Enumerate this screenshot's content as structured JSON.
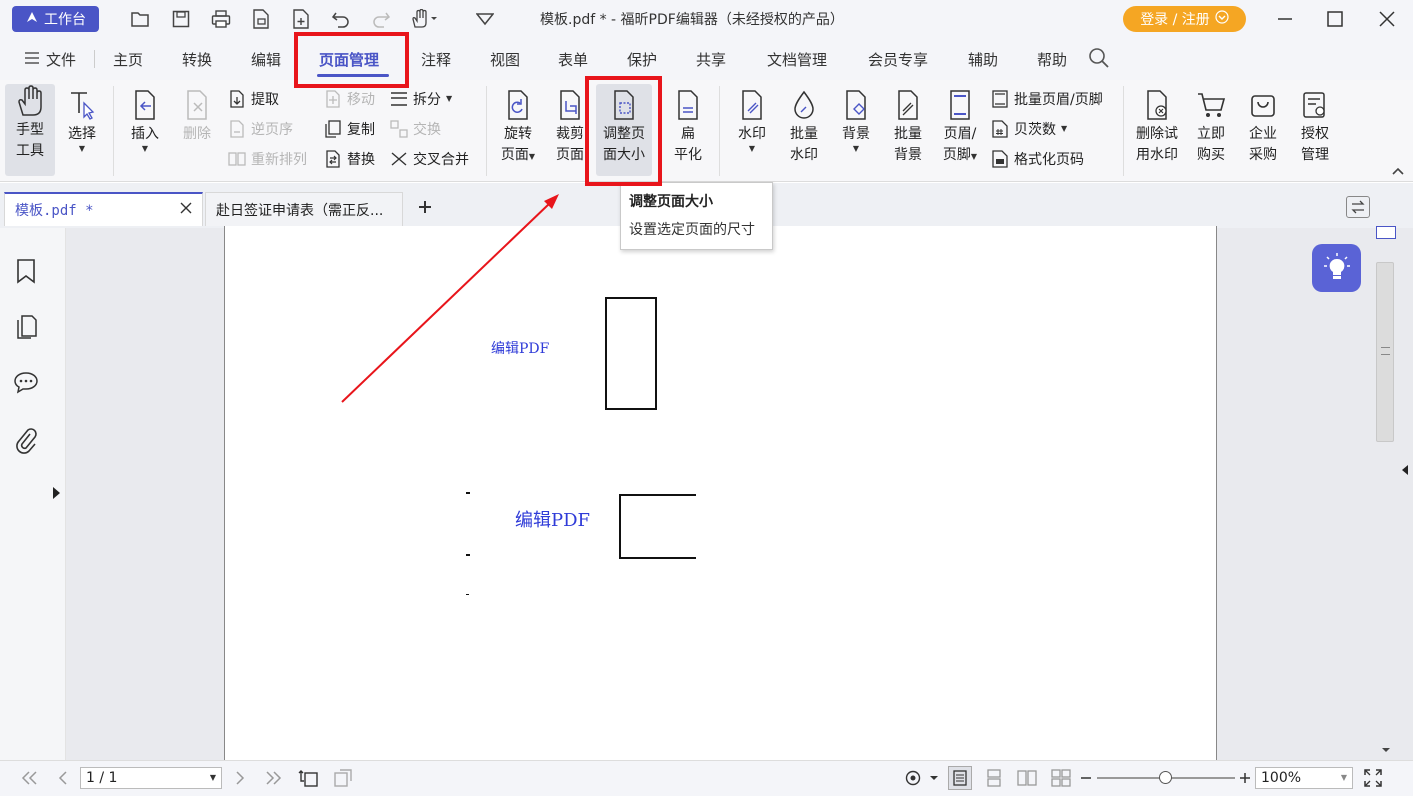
{
  "titlebar": {
    "workspace": "工作台",
    "title": "模板.pdf * - 福昕PDF编辑器（未经授权的产品）",
    "login": "登录 / 注册"
  },
  "menu": [
    "文件",
    "主页",
    "转换",
    "编辑",
    "页面管理",
    "注释",
    "视图",
    "表单",
    "保护",
    "共享",
    "文档管理",
    "会员专享",
    "辅助",
    "帮助"
  ],
  "menu_active": "页面管理",
  "ribbon": {
    "hand": [
      "手型",
      "工具"
    ],
    "select": "选择",
    "insert": "插入",
    "delete": "删除",
    "extract": "提取",
    "reverse": "逆页序",
    "reorder": "重新排列",
    "move": "移动",
    "copy": "复制",
    "replace": "替换",
    "split": "拆分",
    "swap": "交换",
    "cross_merge": "交叉合并",
    "rotate": [
      "旋转",
      "页面"
    ],
    "crop": [
      "裁剪",
      "页面"
    ],
    "resize": [
      "调整页",
      "面大小"
    ],
    "flatten": [
      "扁",
      "平化"
    ],
    "watermark": "水印",
    "batch_watermark": [
      "批量",
      "水印"
    ],
    "background": "背景",
    "batch_background": [
      "批量",
      "背景"
    ],
    "header_footer": [
      "页眉/",
      "页脚"
    ],
    "batch_header_footer": "批量页眉/页脚",
    "bates": "贝茨数",
    "format_page_num": "格式化页码",
    "remove_trial": [
      "删除试",
      "用水印"
    ],
    "buy_now": [
      "立即",
      "购买"
    ],
    "enterprise": [
      "企业",
      "采购"
    ],
    "license": [
      "授权",
      "管理"
    ]
  },
  "tabs": [
    {
      "label": "模板.pdf *"
    },
    {
      "label": "赴日签证申请表（需正反..."
    }
  ],
  "tooltip": {
    "title": "调整页面大小",
    "desc": "设置选定页面的尺寸"
  },
  "document": {
    "text1": "编辑PDF",
    "text2": "编辑PDF"
  },
  "status": {
    "page": "1 / 1",
    "zoom": "100%"
  },
  "colors": {
    "accent": "#4a55c6",
    "highlight": "#e8151b",
    "login": "#f5a623"
  }
}
